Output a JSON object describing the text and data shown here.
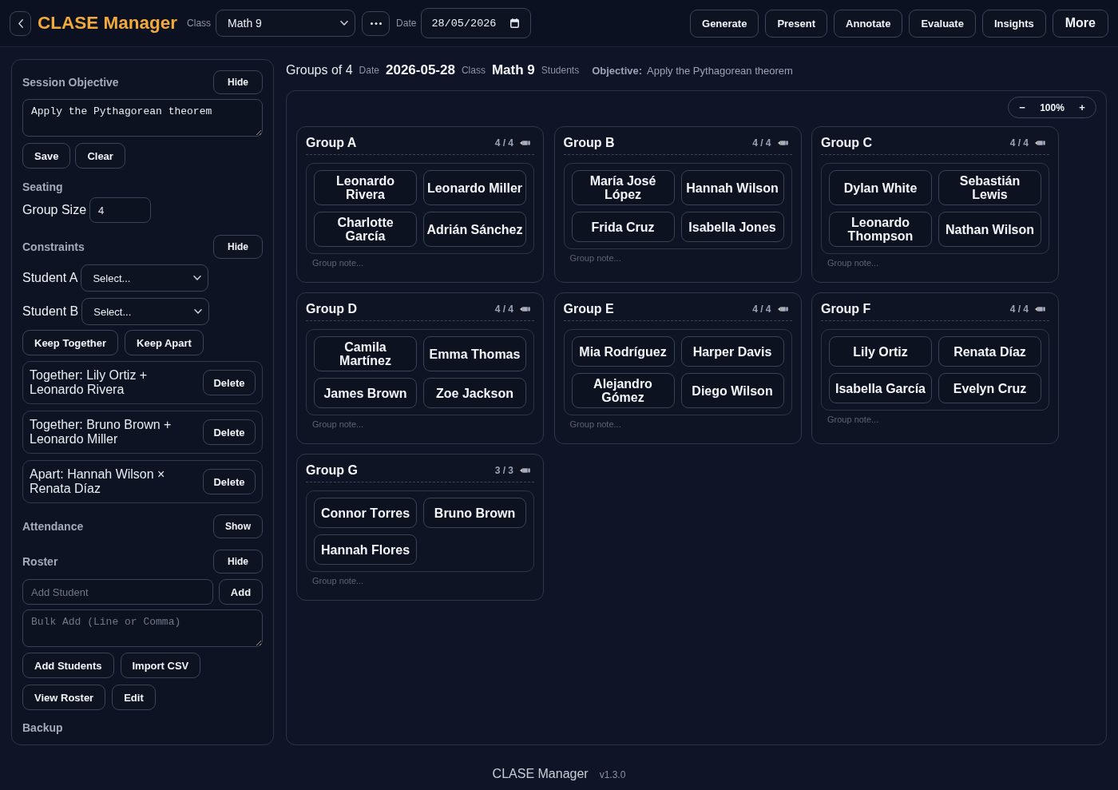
{
  "top_bar": {
    "app_title": "CLASE Manager",
    "class_label": "Class",
    "class_select": {
      "value": "Math 9"
    },
    "date_label": "Date",
    "date_field": {
      "value": "28/05/2026"
    },
    "actions": [
      {
        "label": "Generate",
        "kind": "action"
      },
      {
        "label": "Present",
        "kind": "action"
      },
      {
        "label": "Annotate",
        "kind": "action"
      },
      {
        "label": "Evaluate",
        "kind": "action"
      },
      {
        "label": "Insights",
        "kind": "action"
      },
      {
        "label": "More",
        "kind": "menu"
      }
    ]
  },
  "sidebar": {
    "session_objective": {
      "heading": "Session Objective",
      "toggle": "Hide",
      "objective": {
        "value": "Apply the Pythagorean theorem"
      },
      "buttons": [
        "Save",
        "Clear"
      ]
    },
    "seating": {
      "heading": "Seating",
      "group_size": {
        "label": "Group Size",
        "value": "4"
      }
    },
    "constraints": {
      "heading": "Constraints",
      "toggle": "Hide",
      "pickers": [
        {
          "label": "Student A",
          "value": "Select..."
        },
        {
          "label": "Student B",
          "value": "Select..."
        }
      ],
      "buttons": [
        "Keep Together",
        "Keep Apart"
      ],
      "rules": [
        {
          "text": "Together: Lily Ortiz + Leonardo Rivera",
          "action": "Delete"
        },
        {
          "text": "Together: Bruno Brown + Leonardo Miller",
          "action": "Delete"
        },
        {
          "text": "Apart: Hannah Wilson × Renata Díaz",
          "action": "Delete"
        }
      ]
    },
    "attendance": {
      "heading": "Attendance",
      "toggle": "Show"
    },
    "roster": {
      "heading": "Roster",
      "toggle": "Hide",
      "add_student": {
        "placeholder": "Add Student"
      },
      "add_button": "Add",
      "bulk_add": {
        "placeholder": "Bulk Add (Line or Comma)"
      },
      "button_rows": [
        [
          "Add Students",
          "Import CSV"
        ],
        [
          "View Roster",
          "Edit"
        ]
      ]
    },
    "backup": {
      "heading": "Backup"
    }
  },
  "summary": {
    "title": "Groups of 4",
    "items": [
      {
        "label": "Date",
        "value": "2026-05-28"
      },
      {
        "label": "Class",
        "value": "Math 9"
      },
      {
        "label": "Students"
      }
    ],
    "objective": {
      "label": "Objective:",
      "value": "Apply the Pythagorean theorem"
    }
  },
  "canvas": {
    "zoom": {
      "decrease": "−",
      "value": "100%",
      "increase": "+"
    },
    "groups": [
      {
        "name": "Group A",
        "count": "4 / 4",
        "students": [
          "Leonardo Rivera",
          "Leonardo Miller",
          "Charlotte García",
          "Adrián Sánchez"
        ],
        "note": {
          "placeholder": "Group note..."
        }
      },
      {
        "name": "Group B",
        "count": "4 / 4",
        "students": [
          "María José López",
          "Hannah Wilson",
          "Frida Cruz",
          "Isabella Jones"
        ],
        "note": {
          "placeholder": "Group note..."
        }
      },
      {
        "name": "Group C",
        "count": "4 / 4",
        "students": [
          "Dylan White",
          "Sebastián Lewis",
          "Leonardo Thompson",
          "Nathan Wilson"
        ],
        "note": {
          "placeholder": "Group note..."
        }
      },
      {
        "name": "Group D",
        "count": "4 / 4",
        "students": [
          "Camila Martínez",
          "Emma Thomas",
          "James Brown",
          "Zoe Jackson"
        ],
        "note": {
          "placeholder": "Group note..."
        }
      },
      {
        "name": "Group E",
        "count": "4 / 4",
        "students": [
          "Mia Rodríguez",
          "Harper Davis",
          "Alejandro Gómez",
          "Diego Wilson"
        ],
        "note": {
          "placeholder": "Group note..."
        }
      },
      {
        "name": "Group F",
        "count": "4 / 4",
        "students": [
          "Lily Ortiz",
          "Renata Díaz",
          "Isabella García",
          "Evelyn Cruz"
        ],
        "note": {
          "placeholder": "Group note..."
        }
      },
      {
        "name": "Group G",
        "count": "3 / 3",
        "students": [
          "Connor Torres",
          "Bruno Brown",
          "Hannah Flores"
        ],
        "note": {
          "placeholder": "Group note..."
        }
      }
    ]
  },
  "footer": {
    "app_name": "CLASE Manager",
    "version": "v1.3.0"
  }
}
